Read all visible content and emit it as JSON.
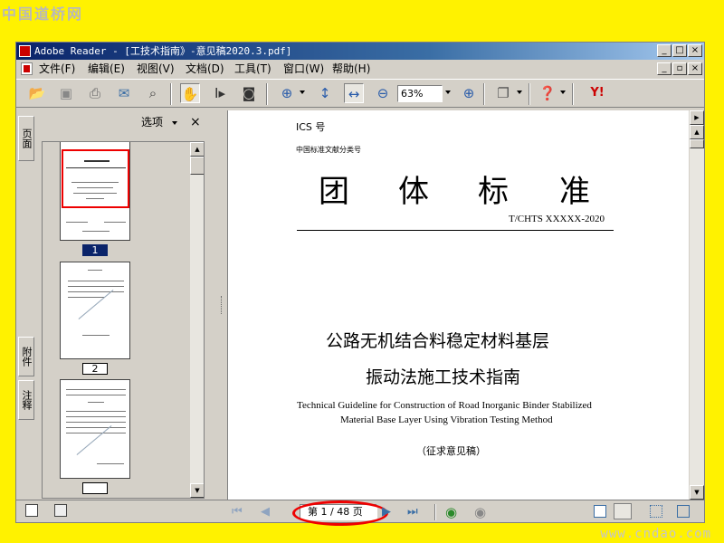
{
  "watermark": {
    "top": "中国道桥网",
    "bottom": "www.cndao.com"
  },
  "window": {
    "title": "Adobe Reader - [工技术指南》-意见稿2020.3.pdf]",
    "caption_buttons": [
      "_",
      "□",
      "×"
    ]
  },
  "menu": {
    "items": [
      "文件(F)",
      "编辑(E)",
      "视图(V)",
      "文档(D)",
      "工具(T)",
      "窗口(W)",
      "帮助(H)"
    ],
    "mdi_buttons": [
      "_",
      "▫",
      "×"
    ]
  },
  "toolbar": {
    "zoom_value": "63%",
    "icons": [
      "open-icon",
      "save-icon",
      "print-icon",
      "email-icon",
      "search-icon",
      "hand-tool-icon",
      "select-text-icon",
      "snapshot-icon",
      "zoom-in-icon",
      "fit-page-icon",
      "fit-width-icon",
      "zoom-out-icon",
      "zoom-increase-icon",
      "page-menu-icon",
      "help-icon",
      "yahoo-icon"
    ],
    "yahoo_label": "Y!"
  },
  "side_tabs": [
    "页面",
    "附件",
    "注释"
  ],
  "pages_panel": {
    "options_label": "选项",
    "close_label": "×",
    "thumbnails": [
      {
        "label": "1",
        "selected": true
      },
      {
        "label": "2",
        "selected": false
      },
      {
        "label": "",
        "selected": false
      }
    ]
  },
  "document": {
    "ics": "ICS 号",
    "category": "中国标准文献分类号",
    "heading_chars": [
      "团",
      "体",
      "标",
      "准"
    ],
    "code": "T/CHTS XXXXX-2020",
    "title_line1": "公路无机结合料稳定材料基层",
    "title_line2": "振动法施工技术指南",
    "english_line1": "Technical Guideline for Construction of Road Inorganic Binder Stabilized",
    "english_line2": "Material Base Layer Using Vibration Testing Method",
    "status": "（征求意见稿）"
  },
  "statusbar": {
    "page_indicator": "第 1 / 48 页",
    "current_page": 1,
    "total_pages": 48
  },
  "colors": {
    "annotation": "#e00000",
    "titlebar": "#0a246a",
    "background": "#fff200"
  }
}
